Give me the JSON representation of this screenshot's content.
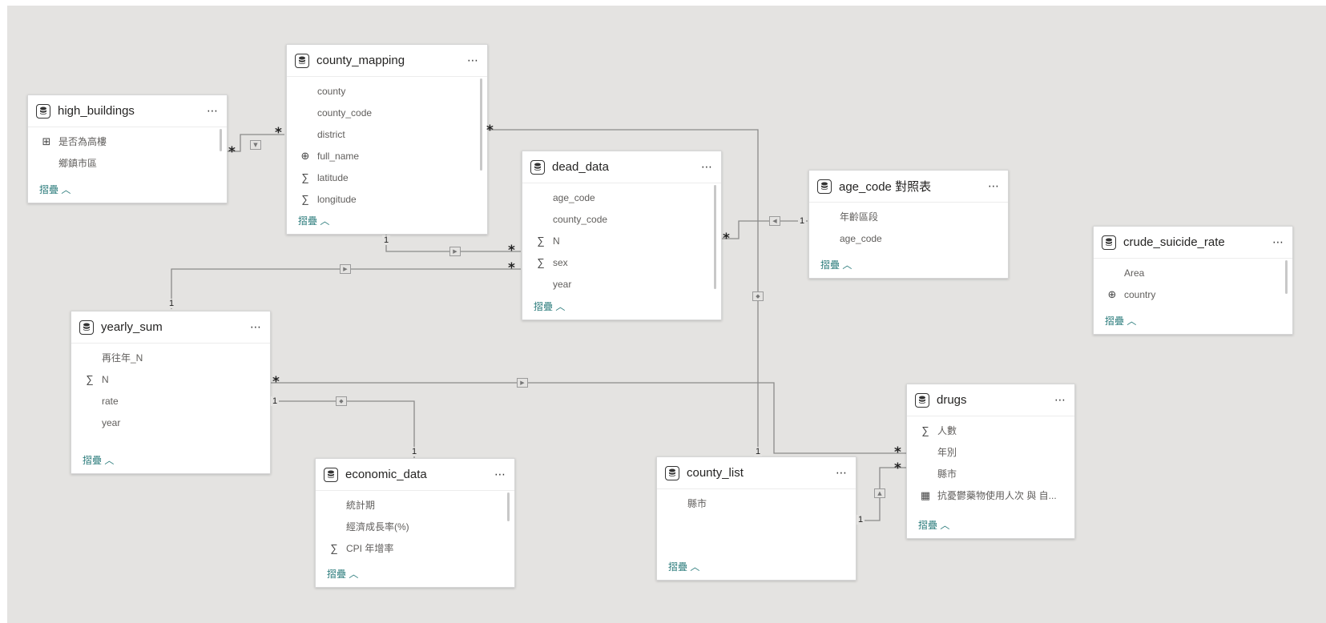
{
  "icons": {
    "table": "table-icon",
    "sigma": "∑",
    "globe": "globe-icon",
    "calc": "calc-icon",
    "more": "⋯"
  },
  "tables": {
    "high_buildings": {
      "title": "high_buildings",
      "fields": [
        "是否為高樓",
        "鄉鎮市區"
      ],
      "collapse": "摺疊 ︿"
    },
    "county_mapping": {
      "title": "county_mapping",
      "fields": [
        "county",
        "county_code",
        "district",
        "full_name",
        "latitude",
        "longitude"
      ],
      "collapse": "摺疊 ︿"
    },
    "dead_data": {
      "title": "dead_data",
      "fields": [
        "age_code",
        "county_code",
        "N",
        "sex",
        "year"
      ],
      "collapse": "摺疊 ︿"
    },
    "age_code": {
      "title": "age_code 對照表",
      "fields": [
        "年齡區段",
        "age_code"
      ],
      "collapse": "摺疊 ︿"
    },
    "crude_suicide_rate": {
      "title": "crude_suicide_rate",
      "fields": [
        "Area",
        "country"
      ],
      "collapse": "摺疊 ︿"
    },
    "yearly_sum": {
      "title": "yearly_sum",
      "fields": [
        "再往年_N",
        "N",
        "rate",
        "year"
      ],
      "collapse": "摺疊 ︿"
    },
    "economic_data": {
      "title": "economic_data",
      "fields": [
        "統計期",
        "經濟成長率(%)",
        "CPI 年增率"
      ],
      "collapse": "摺疊 ︿"
    },
    "county_list": {
      "title": "county_list",
      "fields": [
        "縣市"
      ],
      "collapse": "摺疊 ︿"
    },
    "drugs": {
      "title": "drugs",
      "fields": [
        "人數",
        "年別",
        "縣市",
        "抗憂鬱藥物使用人次 與 自..."
      ],
      "collapse": "摺疊 ︿"
    }
  },
  "cardinality": {
    "many": "*",
    "one": "1"
  }
}
